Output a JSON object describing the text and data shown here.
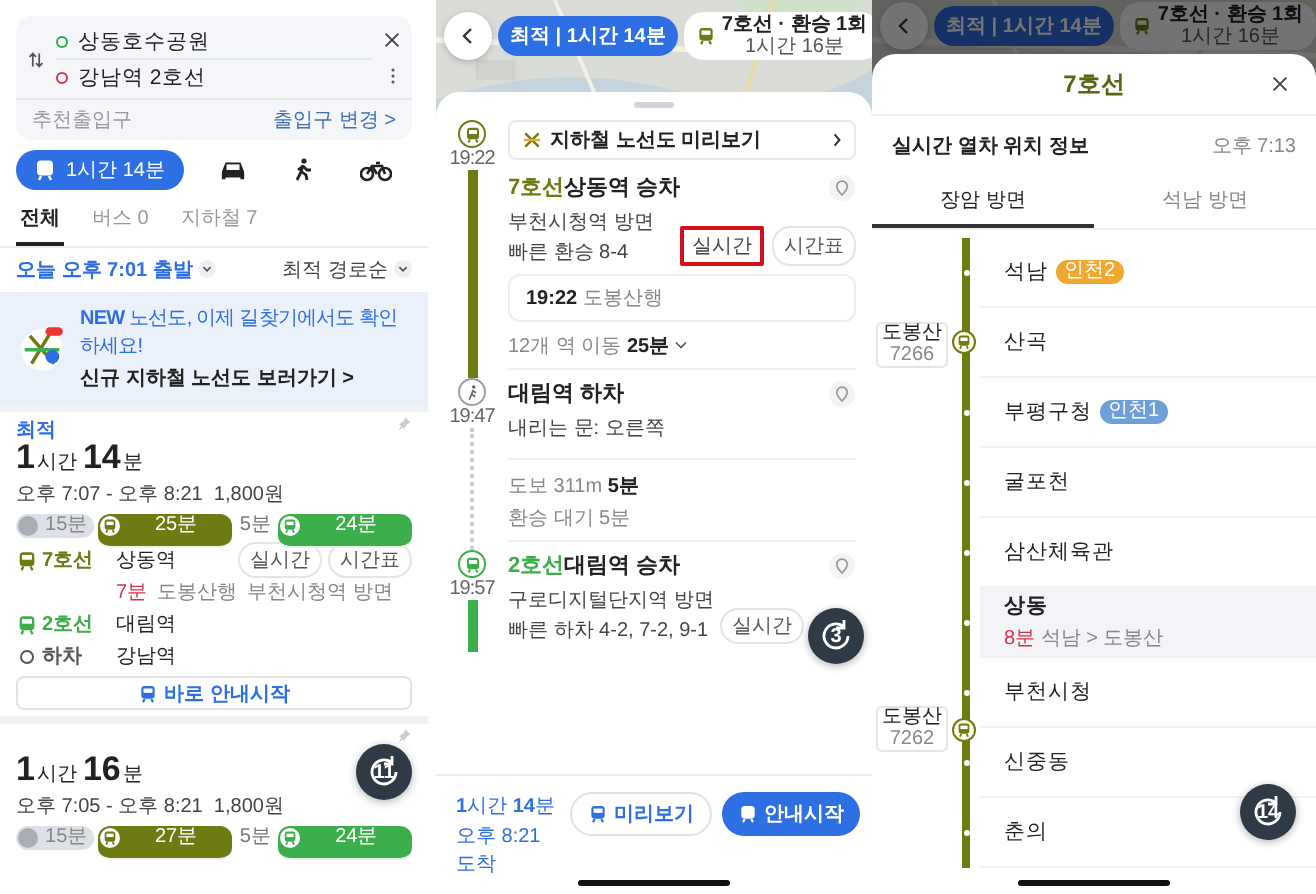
{
  "left": {
    "route": {
      "origin": "상동호수공원",
      "destination": "강남역 2호선",
      "hint": "추천출입구",
      "change_link": "출입구 변경 >"
    },
    "modes": [
      {
        "kind": "transit",
        "label": "1시간 14분",
        "selected": true
      },
      {
        "kind": "car",
        "selected": false
      },
      {
        "kind": "walk",
        "selected": false
      },
      {
        "kind": "bike",
        "selected": false
      }
    ],
    "tabs": [
      {
        "label": "전체",
        "selected": true
      },
      {
        "label": "버스 0",
        "selected": false
      },
      {
        "label": "지하철 7",
        "selected": false
      }
    ],
    "departure": "오늘 오후 7:01 출발",
    "sort": "최적 경로순",
    "banner": {
      "title": "**NEW** 노선도, 이제 길찾기에서도 확인하세요!",
      "link": "신규 지하철 노선도 보러가기 >"
    },
    "routes": [
      {
        "tag": "최적",
        "duration": [
          {
            "value": "1",
            "unit": "시간"
          },
          {
            "value": "14",
            "unit": "분"
          }
        ],
        "times": "오후 7:07 - 오후 8:21",
        "fare": "1,800원",
        "segments": [
          {
            "kind": "walk",
            "label": "15분",
            "color": "#dde1e7"
          },
          {
            "kind": "ride",
            "label": "25분",
            "color": "#6e7a12"
          },
          {
            "kind": "gap",
            "label": "5분",
            "color": "#ffffff"
          },
          {
            "kind": "ride",
            "label": "24분",
            "color": "#3cae4b"
          }
        ],
        "legs": [
          {
            "kind": "ride",
            "line": "7호선",
            "color": "#6e7a12",
            "station": "상동역",
            "actions": [
              "실시간",
              "시간표"
            ],
            "arrival": "7분",
            "details": [
              "도봉산행",
              "부천시청역 방면"
            ]
          },
          {
            "kind": "ride",
            "line": "2호선",
            "color": "#3cae4b",
            "station": "대림역"
          },
          {
            "kind": "alight",
            "line": "하차",
            "color": "#555555",
            "station": "강남역"
          }
        ],
        "start_button": "바로 안내시작"
      },
      {
        "duration": [
          {
            "value": "1",
            "unit": "시간"
          },
          {
            "value": "16",
            "unit": "분"
          }
        ],
        "times": "오후 7:05 - 오후 8:21",
        "fare": "1,800원",
        "segments": [
          {
            "kind": "walk",
            "label": "15분",
            "color": "#dde1e7"
          },
          {
            "kind": "ride",
            "label": "27분",
            "color": "#6e7a12"
          },
          {
            "kind": "gap",
            "label": "5분",
            "color": "#ffffff"
          },
          {
            "kind": "ride",
            "label": "24분",
            "color": "#3cae4b"
          }
        ]
      }
    ],
    "float_badge": "11"
  },
  "middle": {
    "map_tabs": [
      {
        "kind": "plain",
        "label": "최적 | 1시간 14분",
        "selected": true
      },
      {
        "kind": "line",
        "label": "7호선 · 환승 1회",
        "extra": "1시간 16분",
        "selected": false
      }
    ],
    "preview": "지하철 노선도 미리보기",
    "steps": [
      {
        "kind": "board",
        "time": "19:22",
        "color": "#6e7a12",
        "line": "7호선",
        "title": "상동역 승차",
        "lines": [
          "부천시청역 방면",
          "빠른 환승 8-4"
        ],
        "actions": [
          {
            "label": "실시간",
            "highlighted": true
          },
          {
            "label": "시간표",
            "highlighted": false
          }
        ],
        "next_train": {
          "time": "19:22",
          "dest": "도봉산행"
        },
        "ride": {
          "text": "12개 역 이동",
          "duration": "25분"
        }
      },
      {
        "kind": "alight",
        "time": "19:47",
        "color": "#9aa0a8",
        "title": "대림역 하차",
        "lines": [
          "내리는 문: 오른쪽"
        ],
        "walk": {
          "text": "도보 311m",
          "duration": "5분",
          "wait": "환승 대기 5분"
        }
      },
      {
        "kind": "board",
        "time": "19:57",
        "color": "#3cae4b",
        "line": "2호선",
        "title": "대림역 승차",
        "lines": [
          "구로디지털단지역 방면",
          "빠른 하차 4-2, 7-2, 9-1"
        ],
        "actions": [
          {
            "label": "실시간",
            "highlighted": false
          }
        ]
      }
    ],
    "float_badge": "3",
    "footer": {
      "duration": "**1**시간 **14**분",
      "arrival": "오후 8:21 도착",
      "buttons": [
        {
          "kind": "secondary",
          "label": "미리보기"
        },
        {
          "kind": "primary",
          "label": "안내시작"
        }
      ]
    }
  },
  "right": {
    "map_tabs": [
      {
        "kind": "plain",
        "label": "최적 | 1시간 14분",
        "selected": true
      },
      {
        "kind": "line",
        "label": "7호선 · 환승 1회",
        "extra": "1시간 16분",
        "selected": false
      }
    ],
    "title": "7호선",
    "info_title": "실시간 열차 위치 정보",
    "time": "오후 7:13",
    "tabs": [
      {
        "label": "장암 방면",
        "selected": true
      },
      {
        "label": "석남 방면",
        "selected": false
      }
    ],
    "stations": [
      {
        "name": "석남",
        "selected": false,
        "badge": {
          "label": "인천2",
          "color": "#f0a830"
        }
      },
      {
        "name": "산곡",
        "selected": false,
        "train": {
          "dest": "도봉산",
          "number": "7266",
          "kind": "at_station"
        }
      },
      {
        "name": "부평구청",
        "selected": false,
        "badge": {
          "label": "인천1",
          "color": "#6f9fd8"
        }
      },
      {
        "name": "굴포천",
        "selected": false
      },
      {
        "name": "삼산체육관",
        "selected": false
      },
      {
        "name": "상동",
        "selected": true,
        "arrival": "8분",
        "route": "석남 > 도봉산"
      },
      {
        "name": "부천시청",
        "selected": false,
        "train": {
          "dest": "도봉산",
          "number": "7262",
          "kind": "between"
        }
      },
      {
        "name": "신중동",
        "selected": false
      },
      {
        "name": "춘의",
        "selected": false
      }
    ],
    "float_badge": "14"
  }
}
